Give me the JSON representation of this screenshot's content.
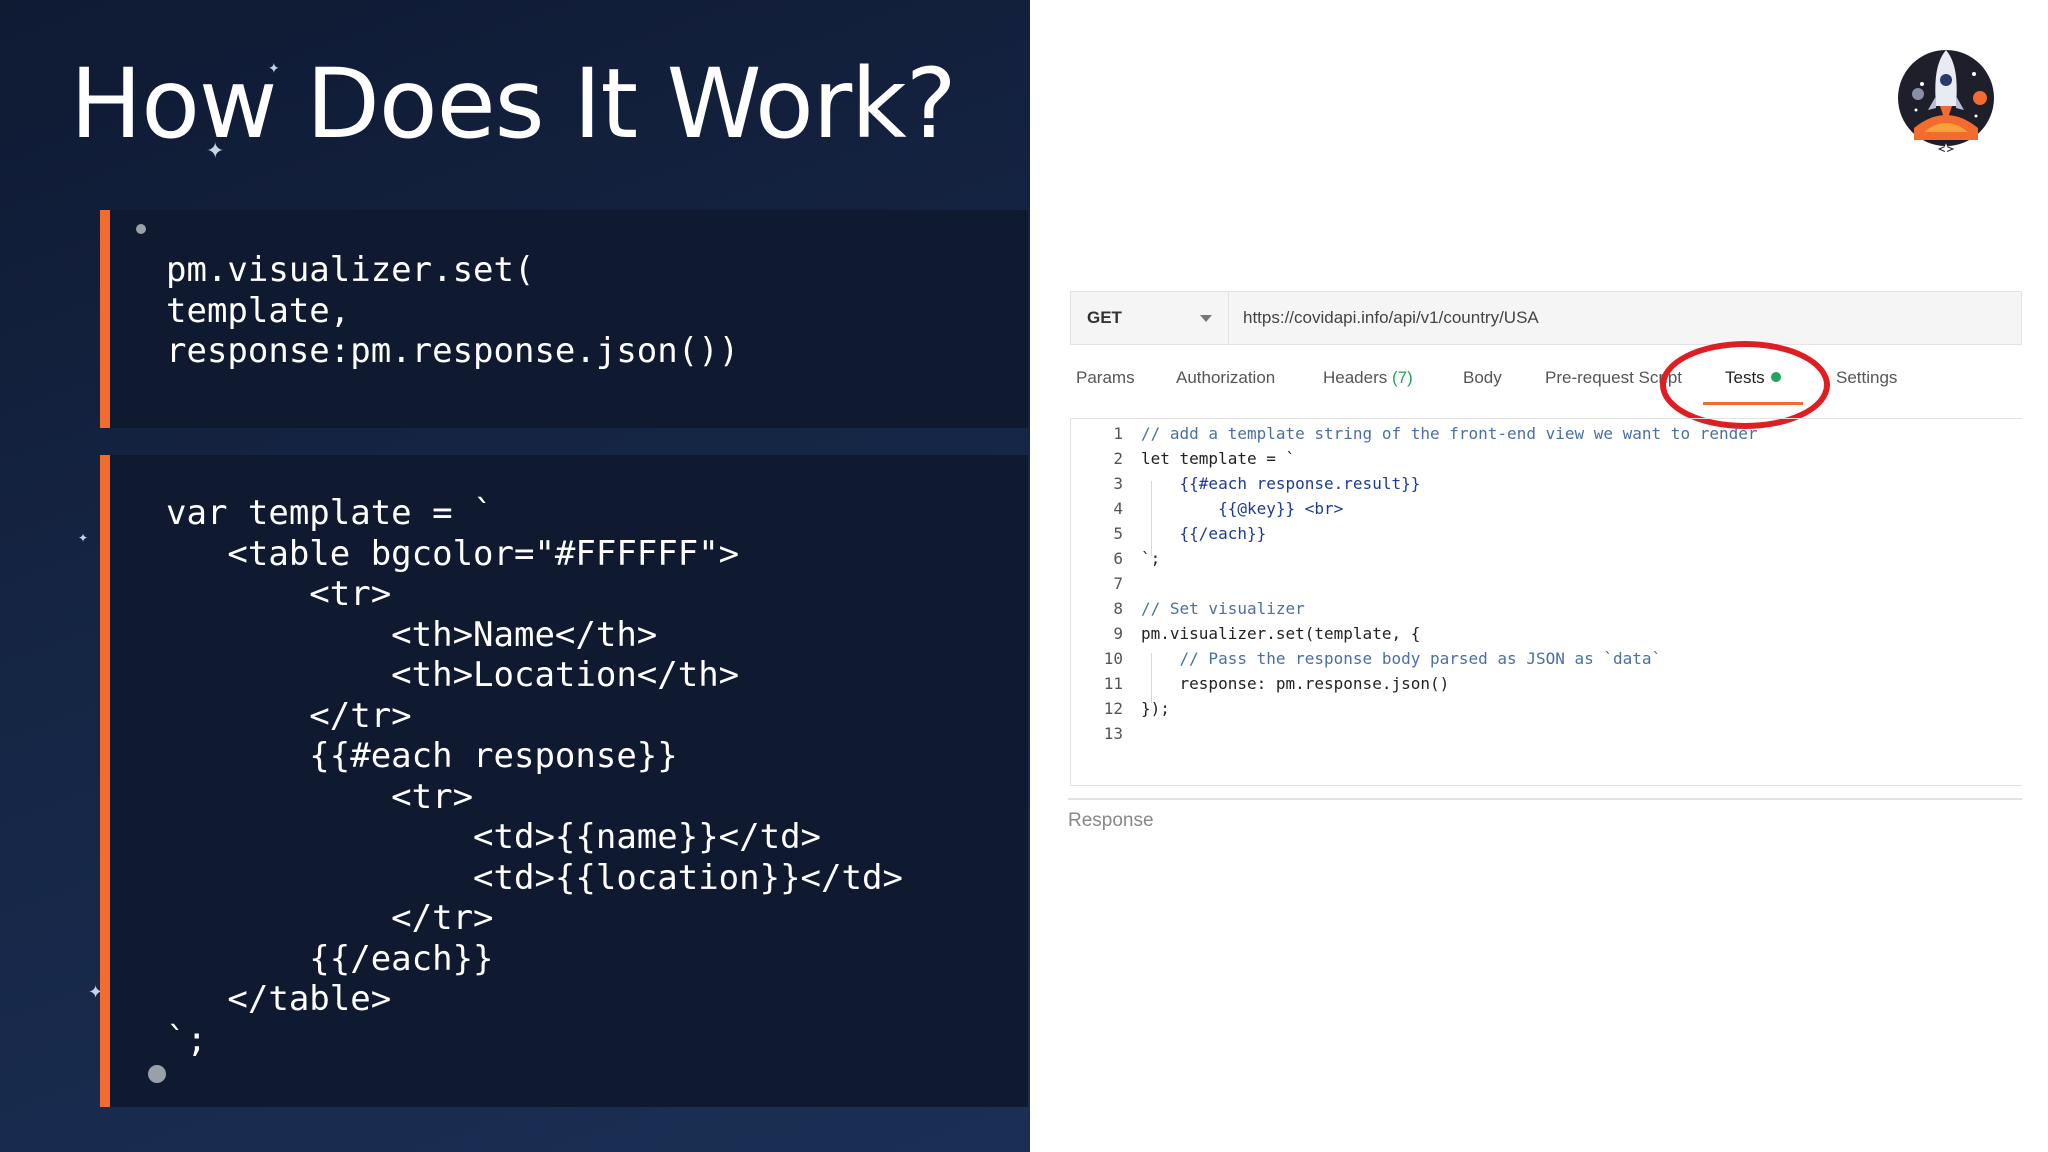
{
  "slide": {
    "title": "How Does It Work?",
    "code_block_1": "pm.visualizer.set(\ntemplate,\nresponse:pm.response.json())",
    "code_block_2": "var template = `\n   <table bgcolor=\"#FFFFFF\">\n       <tr>\n           <th>Name</th>\n           <th>Location</th>\n       </tr>\n       {{#each response}}\n           <tr>\n               <td>{{name}}</td>\n               <td>{{location}}</td>\n           </tr>\n       {{/each}}\n   </table>\n`;"
  },
  "request": {
    "method": "GET",
    "url": "https://covidapi.info/api/v1/country/USA"
  },
  "tabs": [
    {
      "label": "Params"
    },
    {
      "label": "Authorization"
    },
    {
      "label": "Headers",
      "count": "(7)"
    },
    {
      "label": "Body"
    },
    {
      "label": "Pre-request Script"
    },
    {
      "label": "Tests",
      "active": true
    },
    {
      "label": "Settings"
    }
  ],
  "editor": {
    "lines": [
      {
        "num": "1",
        "code": "// add a template string of the front-end view we want to render"
      },
      {
        "num": "2",
        "code": "let template = `"
      },
      {
        "num": "3",
        "code": "    {{#each response.result}}"
      },
      {
        "num": "4",
        "code": "        {{@key}} <br>"
      },
      {
        "num": "5",
        "code": "    {{/each}}"
      },
      {
        "num": "6",
        "code": "`;"
      },
      {
        "num": "7",
        "code": ""
      },
      {
        "num": "8",
        "code": "// Set visualizer"
      },
      {
        "num": "9",
        "code": "pm.visualizer.set(template, {"
      },
      {
        "num": "10",
        "code": "    // Pass the response body parsed as JSON as `data`"
      },
      {
        "num": "11",
        "code": "    response: pm.response.json()"
      },
      {
        "num": "12",
        "code": "});"
      },
      {
        "num": "13",
        "code": ""
      }
    ]
  },
  "response_label": "Response",
  "colors": {
    "accent_orange": "#f26b2f",
    "highlight_red": "#e01e22",
    "status_green": "#27a35a",
    "slide_bg": "#152544",
    "code_bg": "#0f1a30"
  }
}
